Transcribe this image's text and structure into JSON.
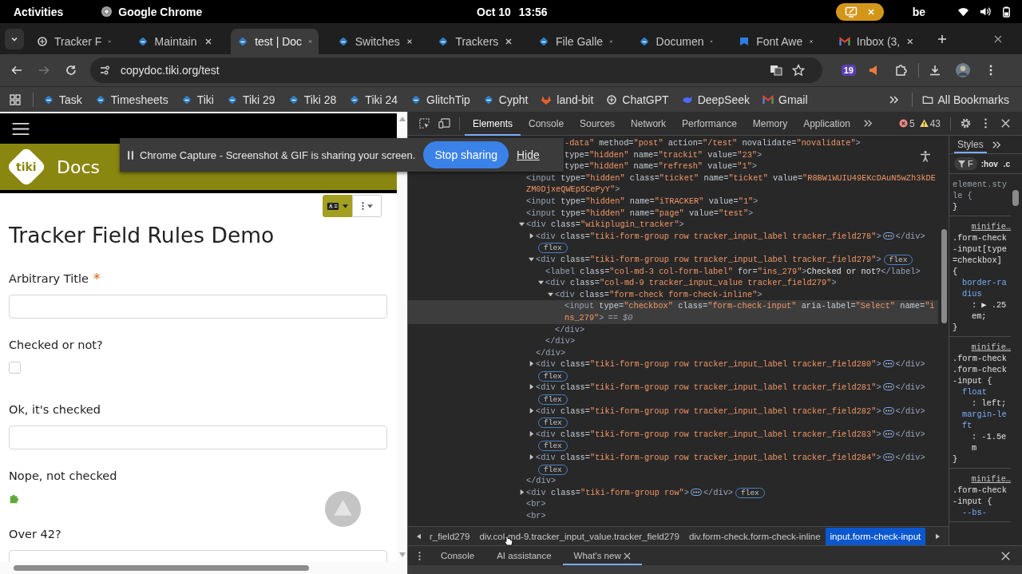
{
  "top_bar": {
    "activities": "Activities",
    "app": "Google Chrome",
    "date": "Oct 10",
    "time": "13:56",
    "keyboard": "be"
  },
  "tabs": [
    {
      "title": "Tracker F",
      "kind": "knot",
      "selected": false
    },
    {
      "title": "Maintain",
      "kind": "tiki",
      "selected": false
    },
    {
      "title": "test | Doc",
      "kind": "tiki",
      "selected": true
    },
    {
      "title": "Switches",
      "kind": "tiki",
      "selected": false
    },
    {
      "title": "Trackers",
      "kind": "tiki",
      "selected": false
    },
    {
      "title": "File Galle",
      "kind": "tiki",
      "selected": false
    },
    {
      "title": "Documen",
      "kind": "tiki",
      "selected": false
    },
    {
      "title": "Font Awe",
      "kind": "flag",
      "selected": false
    },
    {
      "title": "Inbox (3,",
      "kind": "mail",
      "selected": false
    }
  ],
  "address_bar": {
    "url": "copydoc.tiki.org/test",
    "extension_badge": "19"
  },
  "bookmarks": [
    {
      "label": "Task",
      "kind": "tiki"
    },
    {
      "label": "Timesheets",
      "kind": "tiki"
    },
    {
      "label": "Tiki",
      "kind": "tiki"
    },
    {
      "label": "Tiki 29",
      "kind": "tiki"
    },
    {
      "label": "Tiki 28",
      "kind": "tiki"
    },
    {
      "label": "Tiki 24",
      "kind": "tiki"
    },
    {
      "label": "GlitchTip",
      "kind": "tiki"
    },
    {
      "label": "Cypht",
      "kind": "tiki"
    },
    {
      "label": "land-bit",
      "kind": "fox"
    },
    {
      "label": "ChatGPT",
      "kind": "knot"
    },
    {
      "label": "DeepSeek",
      "kind": "whale"
    },
    {
      "label": "Gmail",
      "kind": "mail"
    }
  ],
  "all_bookmarks": "All Bookmarks",
  "page": {
    "logo": "tiki",
    "site_name": "Docs",
    "title": "Tracker Field Rules Demo",
    "fields": [
      {
        "label": "Arbitrary Title",
        "marker": "*",
        "kind": "text"
      },
      {
        "label": "Checked or not?",
        "kind": "checkbox",
        "checked": false
      },
      {
        "label": "Ok, it's checked",
        "kind": "text"
      },
      {
        "label": "Nope, not checked",
        "kind": "plugin"
      },
      {
        "label": "Over 42?",
        "kind": "text"
      }
    ]
  },
  "capture_bar": {
    "message": "Chrome Capture - Screenshot & GIF is sharing your screen.",
    "stop": "Stop sharing",
    "hide": "Hide"
  },
  "devtools": {
    "tabs": [
      {
        "label": "Elements",
        "selected": true
      },
      {
        "label": "Console",
        "selected": false
      },
      {
        "label": "Sources",
        "selected": false
      },
      {
        "label": "Network",
        "selected": false
      },
      {
        "label": "Performance",
        "selected": false
      },
      {
        "label": "Memory",
        "selected": false
      },
      {
        "label": "Application",
        "selected": false
      }
    ],
    "errors": "5",
    "warnings": "43",
    "covered_lines": [
      [
        {
          "kind": "val",
          "text": "-data\""
        },
        {
          "kind": "attr",
          "text": " method="
        },
        {
          "kind": "val",
          "text": "\"post\""
        },
        {
          "kind": "attr",
          "text": " action="
        },
        {
          "kind": "val",
          "text": "\"/test\""
        },
        {
          "kind": "attr",
          "text": " novalidate="
        },
        {
          "kind": "val",
          "text": "\"novalidate\""
        },
        {
          "kind": "tag",
          "text": ">"
        }
      ],
      [
        {
          "kind": "attr",
          "text": "type="
        },
        {
          "kind": "val",
          "text": "\"hidden\""
        },
        {
          "kind": "attr",
          "text": " name="
        },
        {
          "kind": "val",
          "text": "\"trackit\""
        },
        {
          "kind": "attr",
          "text": " value="
        },
        {
          "kind": "val",
          "text": "\"23\""
        },
        {
          "kind": "tag",
          "text": ">"
        }
      ],
      [
        {
          "kind": "attr",
          "text": "type="
        },
        {
          "kind": "val",
          "text": "\"hidden\""
        },
        {
          "kind": "attr",
          "text": " name="
        },
        {
          "kind": "val",
          "text": "\"refresh\""
        },
        {
          "kind": "attr",
          "text": " value="
        },
        {
          "kind": "val",
          "text": "\"1\""
        },
        {
          "kind": "tag",
          "text": ">"
        }
      ]
    ],
    "tree": [
      {
        "open": [
          {
            "kind": "tag",
            "text": "<input"
          },
          {
            "kind": "attr",
            "text": " type="
          },
          {
            "kind": "val",
            "text": "\"hidden\""
          },
          {
            "kind": "attr",
            "text": " class="
          },
          {
            "kind": "val",
            "text": "\"ticket\""
          },
          {
            "kind": "attr",
            "text": " name="
          },
          {
            "kind": "val",
            "text": "\"ticket\""
          },
          {
            "kind": "attr",
            "text": " value="
          },
          {
            "kind": "val",
            "text": "\"R8BW1WUIU49EKcDAuN5wZh3kDEZM0DjxeQWEp5CePyY\""
          },
          {
            "kind": "tag",
            "text": ">"
          }
        ],
        "selected": false
      },
      {
        "open": [
          {
            "kind": "tag",
            "text": "<input"
          },
          {
            "kind": "attr",
            "text": " type="
          },
          {
            "kind": "val",
            "text": "\"hidden\""
          },
          {
            "kind": "attr",
            "text": " name="
          },
          {
            "kind": "val",
            "text": "\"iTRACKER\""
          },
          {
            "kind": "attr",
            "text": " value="
          },
          {
            "kind": "val",
            "text": "\"1\""
          },
          {
            "kind": "tag",
            "text": ">"
          }
        ],
        "selected": false
      },
      {
        "open": [
          {
            "kind": "tag",
            "text": "<input"
          },
          {
            "kind": "attr",
            "text": " type="
          },
          {
            "kind": "val",
            "text": "\"hidden\""
          },
          {
            "kind": "attr",
            "text": " name="
          },
          {
            "kind": "val",
            "text": "\"page\""
          },
          {
            "kind": "attr",
            "text": " value="
          },
          {
            "kind": "val",
            "text": "\"test\""
          },
          {
            "kind": "tag",
            "text": ">"
          }
        ],
        "selected": false
      },
      {
        "open": [
          {
            "kind": "tag",
            "text": "<div"
          },
          {
            "kind": "attr",
            "text": " class="
          },
          {
            "kind": "val",
            "text": "\"wikiplugin_tracker\""
          },
          {
            "kind": "tag",
            "text": ">"
          }
        ],
        "expanded": true,
        "selected": false,
        "close": [
          {
            "kind": "tag",
            "text": "</div>"
          }
        ],
        "children": [
          {
            "open": [
              {
                "kind": "tag",
                "text": "<div"
              },
              {
                "kind": "attr",
                "text": " class="
              },
              {
                "kind": "val",
                "text": "\"tiki-form-group row tracker_input_label tracker_field278\""
              },
              {
                "kind": "tag",
                "text": ">"
              }
            ],
            "expanded": false,
            "close": [
              {
                "kind": "tag",
                "text": "</div>"
              }
            ],
            "badge": "flex",
            "selected": false
          },
          {
            "open": [
              {
                "kind": "tag",
                "text": "<div"
              },
              {
                "kind": "attr",
                "text": " class="
              },
              {
                "kind": "val",
                "text": "\"tiki-form-group row tracker_input_label tracker_field279\""
              },
              {
                "kind": "tag",
                "text": ">"
              }
            ],
            "expanded": true,
            "close": [
              {
                "kind": "tag",
                "text": "</div>"
              }
            ],
            "badge": "flex",
            "selected": false,
            "children": [
              {
                "open": [
                  {
                    "kind": "tag",
                    "text": "<label"
                  },
                  {
                    "kind": "attr",
                    "text": " class="
                  },
                  {
                    "kind": "val",
                    "text": "\"col-md-3 col-form-label\""
                  },
                  {
                    "kind": "attr",
                    "text": " for="
                  },
                  {
                    "kind": "val",
                    "text": "\"ins_279\""
                  },
                  {
                    "kind": "tag",
                    "text": ">"
                  },
                  {
                    "kind": "text",
                    "text": "Checked or not?"
                  },
                  {
                    "kind": "tag",
                    "text": "</label>"
                  }
                ],
                "selected": false
              },
              {
                "open": [
                  {
                    "kind": "tag",
                    "text": "<div"
                  },
                  {
                    "kind": "attr",
                    "text": " class="
                  },
                  {
                    "kind": "val",
                    "text": "\"col-md-9 tracker_input_value tracker_field279\""
                  },
                  {
                    "kind": "tag",
                    "text": ">"
                  }
                ],
                "expanded": true,
                "close": [
                  {
                    "kind": "tag",
                    "text": "</div>"
                  }
                ],
                "selected": false,
                "children": [
                  {
                    "open": [
                      {
                        "kind": "tag",
                        "text": "<div"
                      },
                      {
                        "kind": "attr",
                        "text": " class="
                      },
                      {
                        "kind": "val",
                        "text": "\"form-check form-check-inline\""
                      },
                      {
                        "kind": "tag",
                        "text": ">"
                      }
                    ],
                    "expanded": true,
                    "close": [
                      {
                        "kind": "tag",
                        "text": "</div>"
                      }
                    ],
                    "selected": false,
                    "children": [
                      {
                        "open": [
                          {
                            "kind": "tag",
                            "text": "<input"
                          },
                          {
                            "kind": "attr",
                            "text": " type="
                          },
                          {
                            "kind": "val",
                            "text": "\"checkbox\""
                          },
                          {
                            "kind": "attr",
                            "text": " class="
                          },
                          {
                            "kind": "val",
                            "text": "\"form-check-input\""
                          },
                          {
                            "kind": "attr",
                            "text": " aria-label="
                          },
                          {
                            "kind": "val",
                            "text": "\"Select\""
                          },
                          {
                            "kind": "attr",
                            "text": " name="
                          },
                          {
                            "kind": "val",
                            "text": "\"ins_279\""
                          },
                          {
                            "kind": "tag",
                            "text": ">"
                          }
                        ],
                        "suffix": "== $0",
                        "selected": true
                      }
                    ]
                  }
                ]
              }
            ]
          },
          {
            "open": [
              {
                "kind": "tag",
                "text": "<div"
              },
              {
                "kind": "attr",
                "text": " class="
              },
              {
                "kind": "val",
                "text": "\"tiki-form-group row tracker_input_label tracker_field280\""
              },
              {
                "kind": "tag",
                "text": ">"
              }
            ],
            "expanded": false,
            "close": [
              {
                "kind": "tag",
                "text": "</div>"
              }
            ],
            "badge": "flex",
            "selected": false
          },
          {
            "open": [
              {
                "kind": "tag",
                "text": "<div"
              },
              {
                "kind": "attr",
                "text": " class="
              },
              {
                "kind": "val",
                "text": "\"tiki-form-group row tracker_input_label tracker_field281\""
              },
              {
                "kind": "tag",
                "text": ">"
              }
            ],
            "expanded": false,
            "close": [
              {
                "kind": "tag",
                "text": "</div>"
              }
            ],
            "badge": "flex",
            "selected": false
          },
          {
            "open": [
              {
                "kind": "tag",
                "text": "<div"
              },
              {
                "kind": "attr",
                "text": " class="
              },
              {
                "kind": "val",
                "text": "\"tiki-form-group row tracker_input_label tracker_field282\""
              },
              {
                "kind": "tag",
                "text": ">"
              }
            ],
            "expanded": false,
            "close": [
              {
                "kind": "tag",
                "text": "</div>"
              }
            ],
            "badge": "flex",
            "selected": false
          },
          {
            "open": [
              {
                "kind": "tag",
                "text": "<div"
              },
              {
                "kind": "attr",
                "text": " class="
              },
              {
                "kind": "val",
                "text": "\"tiki-form-group row tracker_input_label tracker_field283\""
              },
              {
                "kind": "tag",
                "text": ">"
              }
            ],
            "expanded": false,
            "close": [
              {
                "kind": "tag",
                "text": "</div>"
              }
            ],
            "badge": "flex",
            "selected": false
          },
          {
            "open": [
              {
                "kind": "tag",
                "text": "<div"
              },
              {
                "kind": "attr",
                "text": " class="
              },
              {
                "kind": "val",
                "text": "\"tiki-form-group row tracker_input_label tracker_field284\""
              },
              {
                "kind": "tag",
                "text": ">"
              }
            ],
            "expanded": false,
            "close": [
              {
                "kind": "tag",
                "text": "</div>"
              }
            ],
            "badge": "flex",
            "selected": false
          }
        ]
      },
      {
        "open": [
          {
            "kind": "tag",
            "text": "<div"
          },
          {
            "kind": "attr",
            "text": " class="
          },
          {
            "kind": "val",
            "text": "\"tiki-form-group row\""
          },
          {
            "kind": "tag",
            "text": ">"
          }
        ],
        "expanded": false,
        "close": [
          {
            "kind": "tag",
            "text": "</div>"
          }
        ],
        "badge": "flex",
        "selected": false
      },
      {
        "open": [
          {
            "kind": "tag",
            "text": "<br>"
          }
        ],
        "selected": false
      },
      {
        "open": [
          {
            "kind": "tag",
            "text": "<br>"
          }
        ],
        "selected": false
      }
    ],
    "styles": {
      "tab": "Styles",
      "filter": "F",
      "hov": ":hov",
      "cls": ".c",
      "element_style": "element.style {",
      "element_close": "}",
      "rules": [
        {
          "source": "minifie…",
          "selector": ".form-check-input[type=checkbox] {",
          "decls": [
            {
              "prop": "border-radius",
              "value": ": ▶ .25em;"
            }
          ],
          "close": "}"
        },
        {
          "source": "minifie…",
          "selector": ".form-check .form-check-input {",
          "decls": [
            {
              "prop": "float",
              "value": ": left;"
            },
            {
              "prop": "margin-left",
              "value": ": -1.5em"
            }
          ],
          "close": "}"
        },
        {
          "source": "minifie…",
          "selector": ".form-check-input {",
          "decls": [
            {
              "prop": "--bs-"
            }
          ]
        }
      ]
    },
    "breadcrumbs": [
      {
        "label": "r_field279",
        "selected": false
      },
      {
        "label": "div.col-md-9.tracker_input_value.tracker_field279",
        "selected": false
      },
      {
        "label": "div.form-check.form-check-inline",
        "selected": false
      },
      {
        "label": "input.form-check-input",
        "selected": true
      }
    ],
    "drawer_tabs": [
      {
        "label": "Console",
        "selected": false
      },
      {
        "label": "AI assistance",
        "selected": false
      },
      {
        "label": "What's new",
        "selected": true
      }
    ]
  }
}
